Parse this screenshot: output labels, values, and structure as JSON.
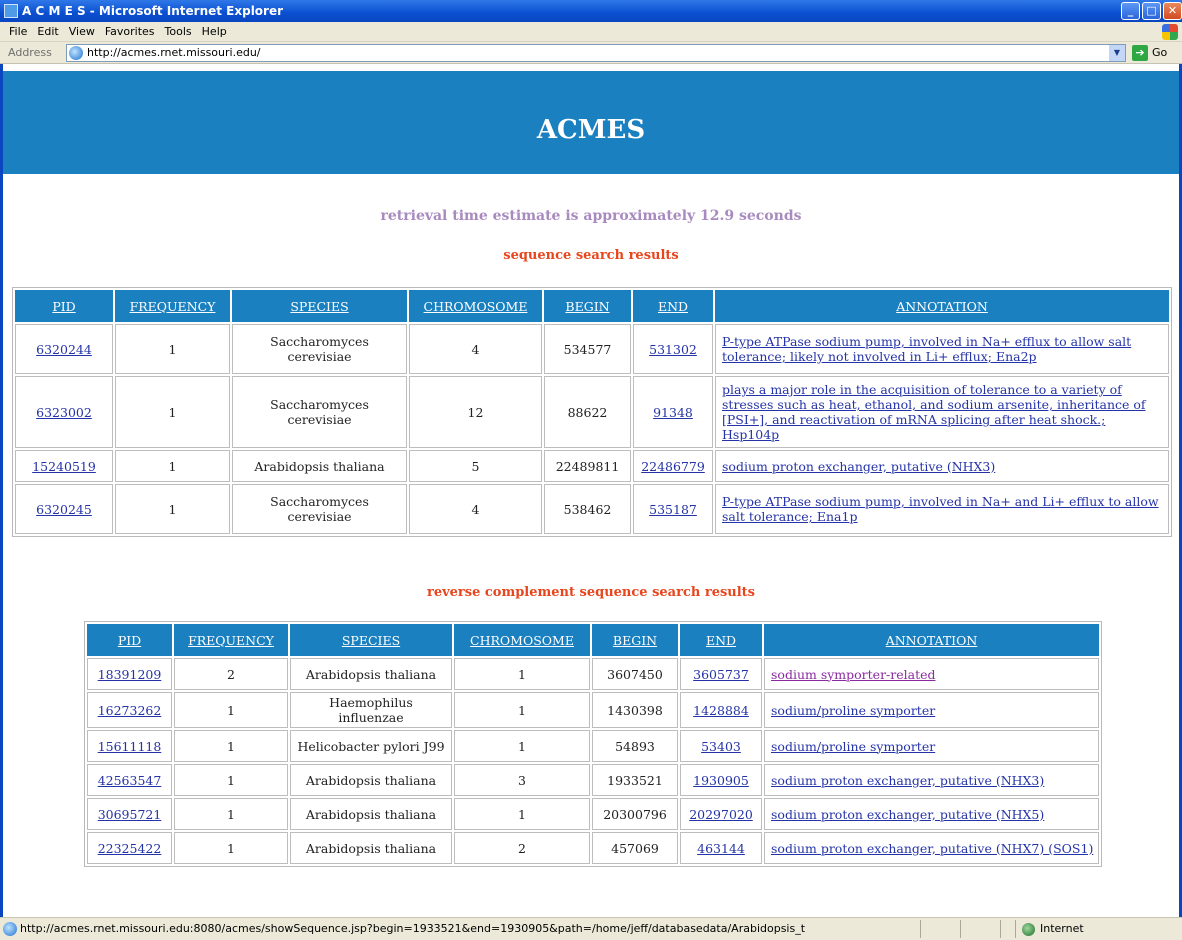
{
  "window": {
    "title": "A C M E S - Microsoft Internet Explorer",
    "minimize": "_",
    "maximize": "□",
    "close": "✕"
  },
  "menu": [
    "File",
    "Edit",
    "View",
    "Favorites",
    "Tools",
    "Help"
  ],
  "address": {
    "label": "Address",
    "url": "http://acmes.rnet.missouri.edu/",
    "go_label": "Go"
  },
  "banner": {
    "title": "ACMES"
  },
  "estimate": "retrieval time estimate is approximately 12.9 seconds",
  "sequence_results": {
    "heading": "sequence search results",
    "columns": [
      "PID",
      "FREQUENCY",
      "SPECIES",
      "CHROMOSOME",
      "BEGIN",
      "END",
      "ANNOTATION"
    ],
    "rows": [
      {
        "pid": "6320244",
        "frequency": "1",
        "species": "Saccharomyces cerevisiae",
        "chromosome": "4",
        "begin": "534577",
        "end": "531302",
        "annotation": "P-type ATPase sodium pump, involved in Na+ efflux to allow salt tolerance; likely not involved in Li+ efflux; Ena2p"
      },
      {
        "pid": "6323002",
        "frequency": "1",
        "species": "Saccharomyces cerevisiae",
        "chromosome": "12",
        "begin": "88622",
        "end": "91348",
        "annotation": "plays a major role in the acquisition of tolerance to a variety of stresses such as heat, ethanol, and sodium arsenite, inheritance of [PSI+], and reactivation of mRNA splicing after heat shock.; Hsp104p"
      },
      {
        "pid": "15240519",
        "frequency": "1",
        "species": "Arabidopsis thaliana",
        "chromosome": "5",
        "begin": "22489811",
        "end": "22486779",
        "annotation": "sodium proton exchanger, putative (NHX3)"
      },
      {
        "pid": "6320245",
        "frequency": "1",
        "species": "Saccharomyces cerevisiae",
        "chromosome": "4",
        "begin": "538462",
        "end": "535187",
        "annotation": "P-type ATPase sodium pump, involved in Na+ and Li+ efflux to allow salt tolerance; Ena1p"
      }
    ]
  },
  "reverse_results": {
    "heading": "reverse complement sequence search results",
    "columns": [
      "PID",
      "FREQUENCY",
      "SPECIES",
      "CHROMOSOME",
      "BEGIN",
      "END",
      "ANNOTATION"
    ],
    "rows": [
      {
        "pid": "18391209",
        "frequency": "2",
        "species": "Arabidopsis thaliana",
        "chromosome": "1",
        "begin": "3607450",
        "end": "3605737",
        "annotation": "sodium symporter-related",
        "visited": true
      },
      {
        "pid": "16273262",
        "frequency": "1",
        "species": "Haemophilus influenzae",
        "chromosome": "1",
        "begin": "1430398",
        "end": "1428884",
        "annotation": "sodium/proline symporter"
      },
      {
        "pid": "15611118",
        "frequency": "1",
        "species": "Helicobacter pylori J99",
        "chromosome": "1",
        "begin": "54893",
        "end": "53403",
        "annotation": "sodium/proline symporter"
      },
      {
        "pid": "42563547",
        "frequency": "1",
        "species": "Arabidopsis thaliana",
        "chromosome": "3",
        "begin": "1933521",
        "end": "1930905",
        "annotation": "sodium proton exchanger, putative (NHX3)"
      },
      {
        "pid": "30695721",
        "frequency": "1",
        "species": "Arabidopsis thaliana",
        "chromosome": "1",
        "begin": "20300796",
        "end": "20297020",
        "annotation": "sodium proton exchanger, putative (NHX5)"
      },
      {
        "pid": "22325422",
        "frequency": "1",
        "species": "Arabidopsis thaliana",
        "chromosome": "2",
        "begin": "457069",
        "end": "463144",
        "annotation": "sodium proton exchanger, putative (NHX7) (SOS1)"
      }
    ]
  },
  "status": {
    "text": "http://acmes.rnet.missouri.edu:8080/acmes/showSequence.jsp?begin=1933521&end=1930905&path=/home/jeff/databasedata/Arabidopsis_t",
    "zone": "Internet"
  },
  "colors": {
    "banner": "#1b80c0",
    "estimate": "#a88abf",
    "heading": "#e8451c",
    "link": "#2533a8",
    "visited_link": "#8a2aa0"
  }
}
